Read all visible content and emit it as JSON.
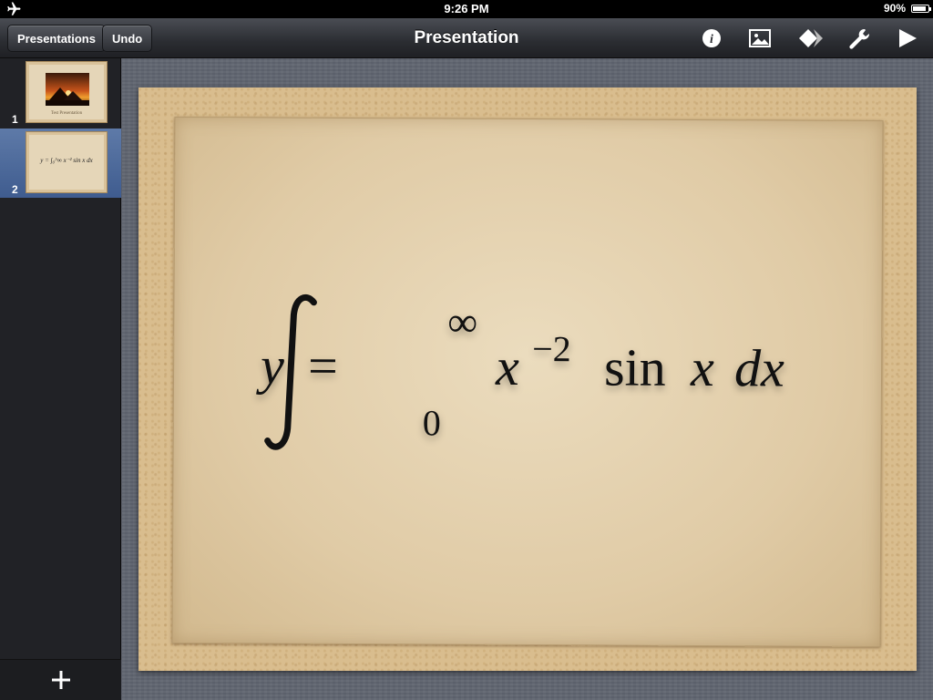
{
  "status_bar": {
    "time": "9:26 PM",
    "battery_percent": "90%",
    "battery_level": 0.9,
    "mode_icon": "airplane-icon"
  },
  "toolbar": {
    "presentations_label": "Presentations",
    "undo_label": "Undo",
    "title": "Presentation",
    "icons": [
      "info-icon",
      "media-icon",
      "shapes-icon",
      "wrench-icon",
      "play-icon"
    ]
  },
  "navigator": {
    "slides": [
      {
        "number": "1",
        "caption": "Test Presentation",
        "thumbnail": "pyramids-photo",
        "selected": false
      },
      {
        "number": "2",
        "formula": "y = ∫₀^∞ x⁻² sin x dx",
        "selected": true
      }
    ],
    "add_icon": "plus-icon"
  },
  "slide": {
    "formula": {
      "y": "y",
      "equals": "=",
      "upper_limit": "∞",
      "lower_limit": "0",
      "base": "x",
      "exponent": "−2",
      "func": "sin",
      "arg": "x",
      "differential": "dx"
    }
  },
  "colors": {
    "selection": "#4a679b",
    "toolbar": "#2b2d32",
    "sidebar": "#212226",
    "canvas": "#606570",
    "slide_border": "#d9bd8e",
    "paper": "#e6d5b4"
  }
}
